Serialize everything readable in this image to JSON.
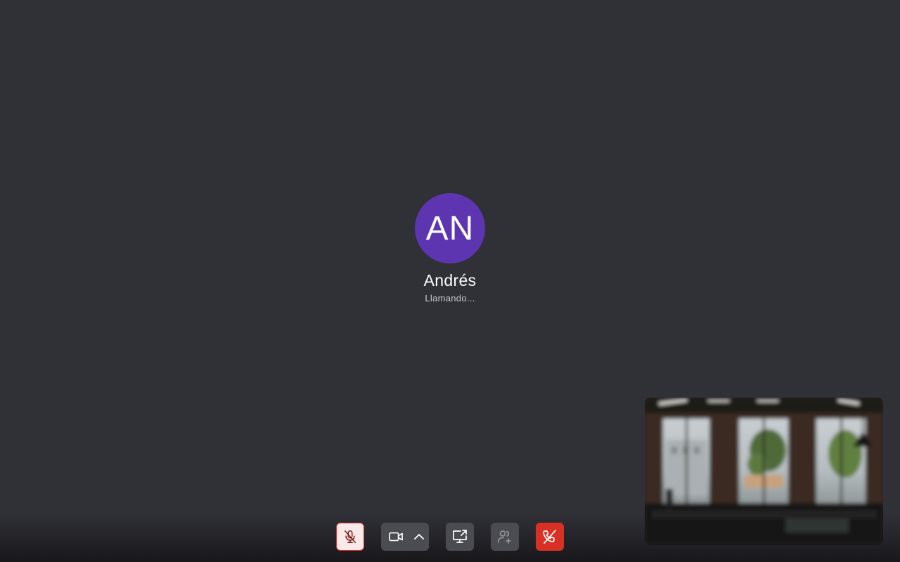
{
  "callee": {
    "initials": "AN",
    "name": "Andrés",
    "status": "Llamando...",
    "avatar_color": "#5e35b1"
  },
  "controls": {
    "mic": {
      "icon": "mic-off-icon",
      "state": "muted"
    },
    "camera": {
      "icon": "video-camera-icon",
      "options_icon": "chevron-up-icon"
    },
    "share_screen": {
      "icon": "screen-share-icon"
    },
    "add_participant": {
      "icon": "add-person-icon",
      "state": "disabled"
    },
    "end_call": {
      "icon": "end-call-icon"
    }
  },
  "self_view": {
    "visible": true
  },
  "colors": {
    "background": "#303037",
    "control_button": "#4b4b52",
    "danger": "#d93025",
    "mic_muted_bg": "#fbe9ea"
  }
}
